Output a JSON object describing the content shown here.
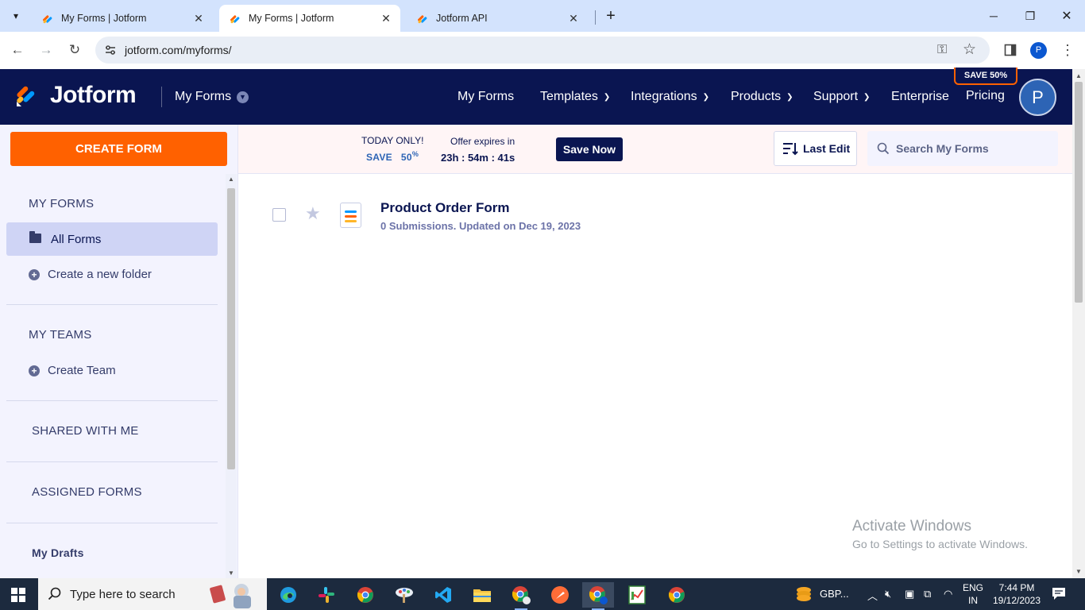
{
  "browser": {
    "tabs": [
      {
        "title": "My Forms | Jotform",
        "active": false
      },
      {
        "title": "My Forms | Jotform",
        "active": true
      },
      {
        "title": "Jotform API",
        "active": false
      }
    ],
    "url": "jotform.com/myforms/",
    "profile_initial": "P"
  },
  "header": {
    "brand": "Jotform",
    "section": "My Forms",
    "nav": [
      {
        "label": "My Forms",
        "dropdown": false
      },
      {
        "label": "Templates",
        "dropdown": true
      },
      {
        "label": "Integrations",
        "dropdown": true
      },
      {
        "label": "Products",
        "dropdown": true
      },
      {
        "label": "Support",
        "dropdown": true
      },
      {
        "label": "Enterprise",
        "dropdown": false
      },
      {
        "label": "Pricing",
        "dropdown": false
      }
    ],
    "save_badge": "SAVE 50%",
    "avatar_initial": "P",
    "colors": {
      "navy": "#0a1551",
      "orange": "#ff6100",
      "blue": "#2d64b5"
    }
  },
  "sidebar": {
    "create_label": "CREATE FORM",
    "my_forms_title": "MY FORMS",
    "all_forms_label": "All Forms",
    "new_folder_label": "Create a new folder",
    "my_teams_title": "MY TEAMS",
    "create_team_label": "Create Team",
    "shared_label": "SHARED WITH ME",
    "assigned_label": "ASSIGNED FORMS",
    "drafts_label": "My Drafts"
  },
  "promo": {
    "today": "TODAY ONLY!",
    "save": "SAVE",
    "percent": "50",
    "percent_sign": "%",
    "expires": "Offer expires in",
    "timer": "23h : 54m : 41s",
    "cta": "Save Now"
  },
  "toolbar": {
    "sort_label": "Last Edit",
    "search_placeholder": "Search My Forms"
  },
  "forms": [
    {
      "title": "Product Order Form",
      "meta": "0 Submissions. Updated on Dec 19, 2023"
    }
  ],
  "watermark": {
    "line1": "Activate Windows",
    "line2": "Go to Settings to activate Windows."
  },
  "taskbar": {
    "search_text": "Type here to search",
    "weather_text": "GBP...",
    "lang_line1": "ENG",
    "lang_line2": "IN",
    "time": "7:44 PM",
    "date": "19/12/2023"
  }
}
